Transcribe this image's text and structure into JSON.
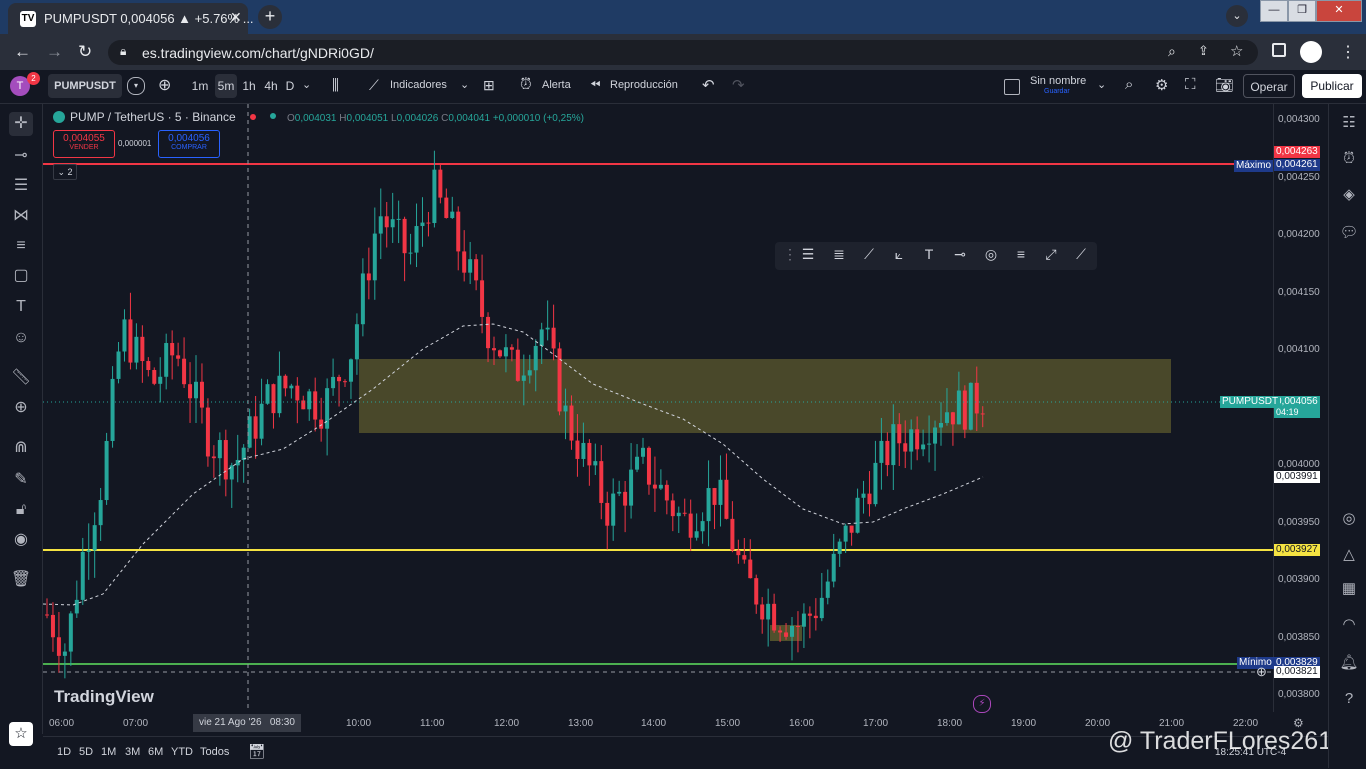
{
  "browser": {
    "tab_title": "PUMPUSDT 0,004056 ▲ +5.76% ...",
    "tab_favicon": "TV",
    "close_glyph": "✕",
    "new_tab": "+",
    "url": "es.tradingview.com/chart/gNDRi0GD/",
    "window_controls": [
      "—",
      "❐",
      "✕"
    ]
  },
  "tv_header": {
    "avatar_letter": "T",
    "notif_count": "2",
    "symbol": "PUMPUSDT",
    "intervals": [
      "1m",
      "5m",
      "1h",
      "4h",
      "D"
    ],
    "active_interval": "5m",
    "indicators": "Indicadores",
    "alert": "Alerta",
    "replay": "Reproducción",
    "layout_name": "Sin nombre",
    "layout_sub": "Guardar",
    "trade_button": "Operar",
    "publish_button": "Publicar"
  },
  "legend": {
    "pair": "PUMP / TetherUS · 5 · Binance",
    "o_label": "O",
    "o": "0,004031",
    "h_label": "H",
    "h": "0,004051",
    "l_label": "L",
    "l": "0,004026",
    "c_label": "C",
    "c": "0,004041",
    "chg": "+0,000010 (+0,25%)",
    "sell_price": "0,004055",
    "sell_label": "VENDER",
    "spread": "0,000001",
    "buy_price": "0,004056",
    "buy_label": "COMPRAR",
    "indicators_count": "2"
  },
  "price_axis": {
    "ticks": [
      "0,004300",
      "0,004250",
      "0,004200",
      "0,004150",
      "0,004100",
      "0,004000",
      "0,003950",
      "0,003900",
      "0,003850",
      "0,003800"
    ],
    "max_label": "Máximo",
    "max_value": "0,004261",
    "red_line_value": "0,004263",
    "current_symbol": "PUMPUSDT",
    "current_value": "0,004056",
    "countdown": "04:19",
    "white_label": "0,003991",
    "yellow_value": "0,003927",
    "min_label": "Mínimo",
    "min_value": "0,003829",
    "cursor_value": "0,003821"
  },
  "time_axis": {
    "ticks": [
      "06:00",
      "07:00",
      "10:00",
      "11:00",
      "12:00",
      "13:00",
      "14:00",
      "15:00",
      "16:00",
      "17:00",
      "18:00",
      "19:00",
      "20:00",
      "21:00",
      "22:00"
    ],
    "cursor_label": "vie 21 Ago '26   08:30"
  },
  "bottom_bar": {
    "ranges": [
      "1D",
      "5D",
      "1M",
      "3M",
      "6M",
      "YTD",
      "Todos"
    ],
    "clock": "18:25:41 UTC-4"
  },
  "watermark": "TradingView",
  "overlay_handle": "@ TraderFLores261",
  "colors": {
    "bull": "#26a69a",
    "bear": "#f23645",
    "zone": "#5c5a2e",
    "yellow_line": "#f5e342",
    "red_line": "#f23645",
    "green_line": "#4caf50"
  },
  "icons": {
    "left_tools": [
      "crosshair-icon",
      "horizontal-line-icon",
      "parallel-channel-icon",
      "pitchfork-icon",
      "fib-icon",
      "rectangle-icon",
      "text-icon",
      "emoji-icon",
      "ruler-icon",
      "zoom-icon",
      "magnet-icon",
      "pencil-lock-icon",
      "lock-icon",
      "eye-icon",
      "trash-icon"
    ],
    "right_tools": [
      "watchlist-icon",
      "alerts-icon",
      "layers-icon",
      "chat-icon",
      "compass-icon",
      "ideas-icon",
      "calendar-icon",
      "streams-icon",
      "notifications-icon",
      "help-icon"
    ]
  }
}
